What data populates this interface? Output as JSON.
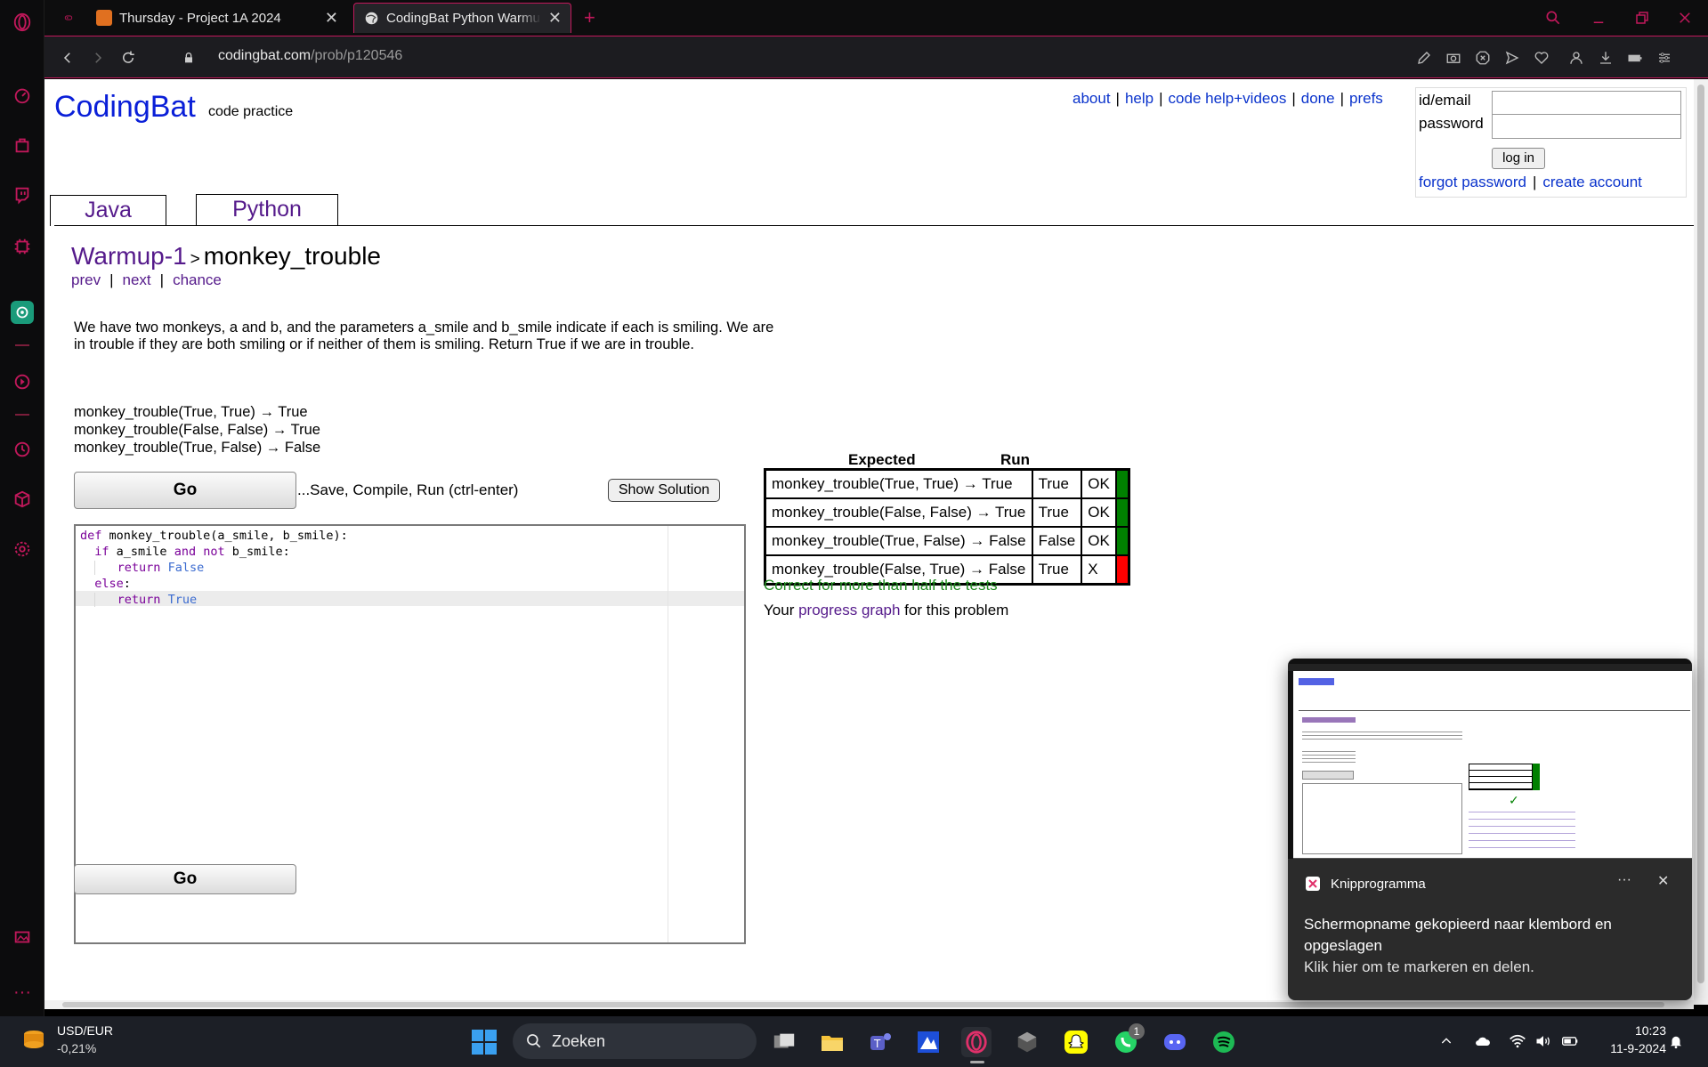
{
  "browser": {
    "tabs": [
      {
        "label": "Thursday - Project 1A 2024",
        "active": false
      },
      {
        "label": "CodingBat Python Warmup",
        "active": true
      }
    ],
    "url_host": "codingbat.com",
    "url_path": "/prob/p120546"
  },
  "site": {
    "logo": "CodingBat",
    "tagline": "code practice",
    "top_links": [
      "about",
      "help",
      "code help+videos",
      "done",
      "prefs"
    ],
    "login": {
      "id_label": "id/email",
      "password_label": "password",
      "button": "log in",
      "forgot": "forgot password",
      "create": "create account"
    },
    "lang_tabs": [
      "Java",
      "Python"
    ]
  },
  "problem": {
    "section": "Warmup-1",
    "name": "monkey_trouble",
    "nav": [
      "prev",
      "next",
      "chance"
    ],
    "description": "We have two monkeys, a and b, and the parameters a_smile and b_smile indicate if each is smiling. We are in trouble if they are both smiling or if neither of them is smiling. Return True if we are in trouble.",
    "examples": [
      "monkey_trouble(True, True) → True",
      "monkey_trouble(False, False) → True",
      "monkey_trouble(True, False) → False"
    ],
    "go_label": "Go",
    "go_hint": "...Save, Compile, Run (ctrl-enter)",
    "show_solution": "Show Solution"
  },
  "code": {
    "lines": [
      [
        "def",
        " monkey_trouble(a_smile, b_smile):"
      ],
      [
        "if",
        " a_smile ",
        "and",
        " ",
        "not",
        " b_smile:"
      ],
      [
        "return",
        " ",
        "False"
      ],
      [
        "else",
        ":"
      ],
      [
        "return",
        " ",
        "True"
      ]
    ]
  },
  "results": {
    "header_expected": "Expected",
    "header_run": "Run",
    "rows": [
      {
        "expected": "monkey_trouble(True, True) → True",
        "run": "True",
        "status": "OK",
        "pass": true
      },
      {
        "expected": "monkey_trouble(False, False) → True",
        "run": "True",
        "status": "OK",
        "pass": true
      },
      {
        "expected": "monkey_trouble(True, False) → False",
        "run": "False",
        "status": "OK",
        "pass": true
      },
      {
        "expected": "monkey_trouble(False, True) → False",
        "run": "True",
        "status": "X",
        "pass": false
      }
    ],
    "summary": "Correct for more than half the tests",
    "progress_pre": "Your",
    "progress_link": "progress graph",
    "progress_post": "for this problem"
  },
  "toast": {
    "app": "Knipprogramma",
    "message": "Schermopname gekopieerd naar klembord en opgeslagen",
    "action": "Klik hier om te markeren en delen."
  },
  "taskbar": {
    "ticker_name": "USD/EUR",
    "ticker_change": "-0,21%",
    "search_placeholder": "Zoeken",
    "whatsapp_badge": "1",
    "time": "10:23",
    "date": "11-9-2024"
  },
  "colors": {
    "opera_accent": "#c2185b",
    "pass": "#008000",
    "fail": "#ff0000",
    "link": "#0a33cc",
    "visited": "#551a8b"
  }
}
